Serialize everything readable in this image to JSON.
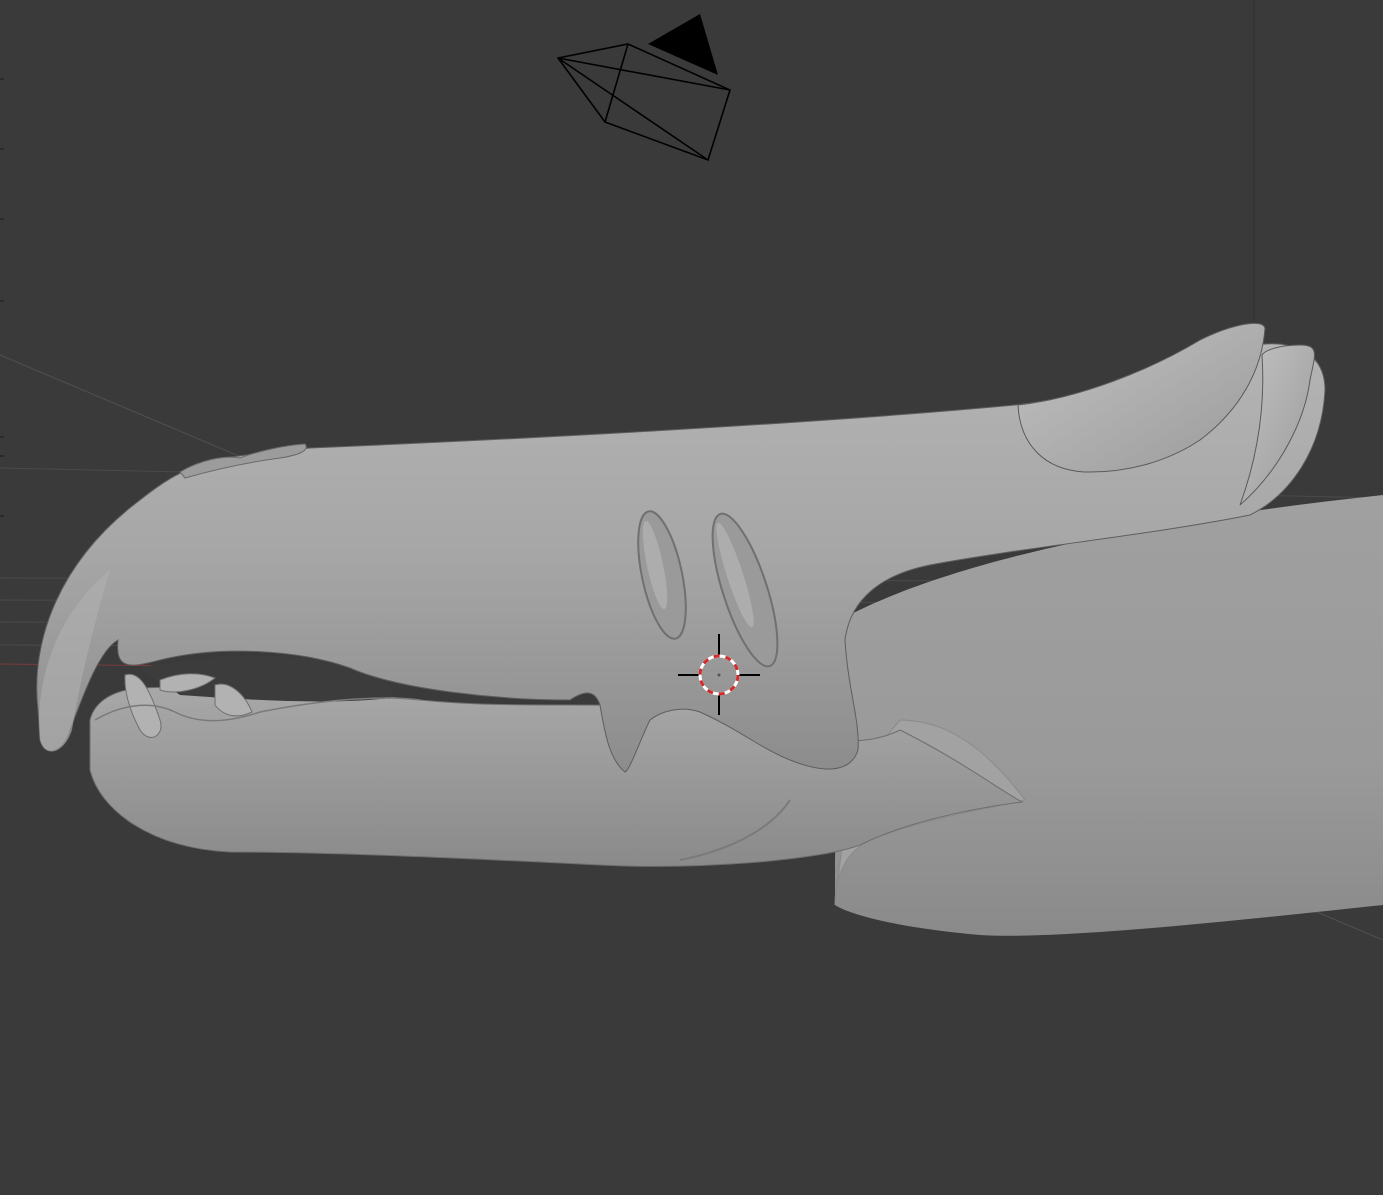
{
  "viewport": {
    "mode": "3D Viewport",
    "background_color": "#3a3a3a",
    "grid_line_color": "#4a4a4a",
    "x_axis_color": "#8a3a3a"
  },
  "scene_objects": {
    "camera": {
      "icon": "camera-icon",
      "color": "#000000"
    },
    "light": {
      "icon": "light-icon",
      "color": "#2a2a2a"
    },
    "model": {
      "icon": "dragon-head-mesh",
      "color": "#a4a4a4",
      "shading": "solid"
    },
    "cursor_3d": {
      "icon": "3d-cursor-icon",
      "ring_colors": [
        "#d42a2a",
        "#ffffff"
      ]
    }
  }
}
